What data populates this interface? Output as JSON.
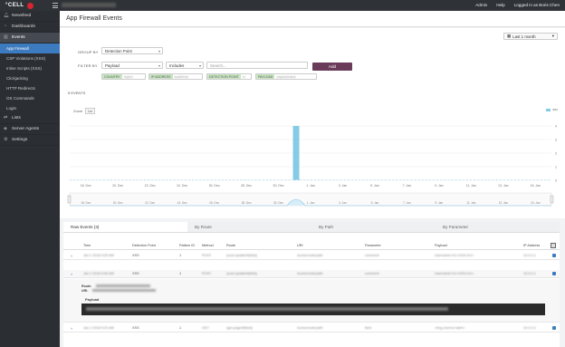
{
  "topbar": {
    "brand_prefix": "°CELL",
    "brand_suffix": "O",
    "links": [
      "Admin",
      "Help",
      "Logged in as Boris Chen"
    ]
  },
  "sidebar": {
    "items": [
      {
        "label": "Newsfeed",
        "icon": "bell-icon"
      },
      {
        "label": "Dashboards",
        "icon": "dashboard-icon"
      },
      {
        "label": "Events",
        "icon": "chart-icon",
        "active": true
      },
      {
        "label": "Lists",
        "icon": "list-icon"
      },
      {
        "label": "Server Agents",
        "icon": "server-icon"
      },
      {
        "label": "Settings",
        "icon": "gear-icon"
      }
    ],
    "events_sub": [
      {
        "label": "App Firewall",
        "active": true
      },
      {
        "label": "CSP Violations (XSS)"
      },
      {
        "label": "Inline Scripts (XSS)"
      },
      {
        "label": "Clickjacking"
      },
      {
        "label": "HTTP Redirects"
      },
      {
        "label": "OS Commands"
      },
      {
        "label": "Login"
      }
    ]
  },
  "page": {
    "title": "App Firewall Events",
    "range": "Last 1 month",
    "group_by_label": "GROUP BY",
    "group_by_value": "Detection Point",
    "filter_by_label": "FILTER BY",
    "filter_field": "Payload",
    "filter_op": "Includes",
    "filter_placeholder": "Search...",
    "add_label": "Add",
    "chips": [
      {
        "tag": "COUNTRY",
        "val": "region"
      },
      {
        "tag": "IP ADDRESS",
        "val": "ipaddress"
      },
      {
        "tag": "DETECTION POINT",
        "val": "rs"
      },
      {
        "tag": "PAYLOAD",
        "val": "payloadvalue"
      }
    ],
    "events_count": "5 EVENTS",
    "zoom_label": "Zoom",
    "zoom_value": "1m",
    "legend": "sec"
  },
  "chart_data": {
    "type": "bar",
    "x_tick_labels": [
      "18. Dec",
      "20. Dec",
      "22. Dec",
      "24. Dec",
      "26. Dec",
      "28. Dec",
      "30. Dec",
      "1. Jan",
      "3. Jan",
      "5. Jan",
      "7. Jan",
      "9. Jan",
      "11. Jan",
      "13. Jan",
      "15. Jan"
    ],
    "navigator_tick_labels": [
      "18. Dec",
      "20. Dec",
      "22. Dec",
      "24. Dec",
      "26. Dec",
      "28. Dec",
      "30. Dec",
      "1. Jan",
      "3. Jan",
      "5. Jan",
      "7. Jan",
      "9. Jan",
      "11. Jan",
      "13. Jan",
      "15. Jan"
    ],
    "y_ticks": [
      0,
      1,
      2,
      3,
      4
    ],
    "ylim": [
      0,
      4
    ],
    "bars": [
      {
        "x": "31. Dec",
        "value": 4
      }
    ],
    "grid": true,
    "color": "#86cbe6"
  },
  "table": {
    "tabs": [
      "Raw Events (3)",
      "By Route",
      "By Path",
      "By Parameter"
    ],
    "columns": [
      "Time",
      "Detection Point",
      "Pattern ID",
      "Method",
      "Route",
      "URI",
      "Parameter",
      "Payload",
      "IP Address"
    ],
    "rows": [
      {
        "time": "Jan 2 2018 5:59 AM",
        "dp": "XSS",
        "pid": "1",
        "method": "POST",
        "route": "/post-update/#{field}",
        "uri": "/some/route/path",
        "param": "comment",
        "payload": "Username<h1>XSS</h1>",
        "ip": "10.0.0.1"
      },
      {
        "time": "Jan 2 2018 5:59 AM",
        "dp": "XSS",
        "pid": "1",
        "method": "POST",
        "route": "/post-update/#{field}",
        "uri": "/some/route/path",
        "param": "comment",
        "payload": "Username<h1>XSS</h1>",
        "ip": "10.0.0.1"
      },
      {
        "time": "Jan 2 2018 5:22 AM",
        "dp": "XSS",
        "pid": "1",
        "method": "GET",
        "route": "/get-page/#{field}",
        "uri": "/some/route/path",
        "param": "field",
        "payload": "<img onerror=alert>",
        "ip": "10.0.0.2"
      }
    ],
    "detail_route_label": "Route:",
    "detail_uri_label": "URI:",
    "detail_payload_label": "Payload"
  }
}
